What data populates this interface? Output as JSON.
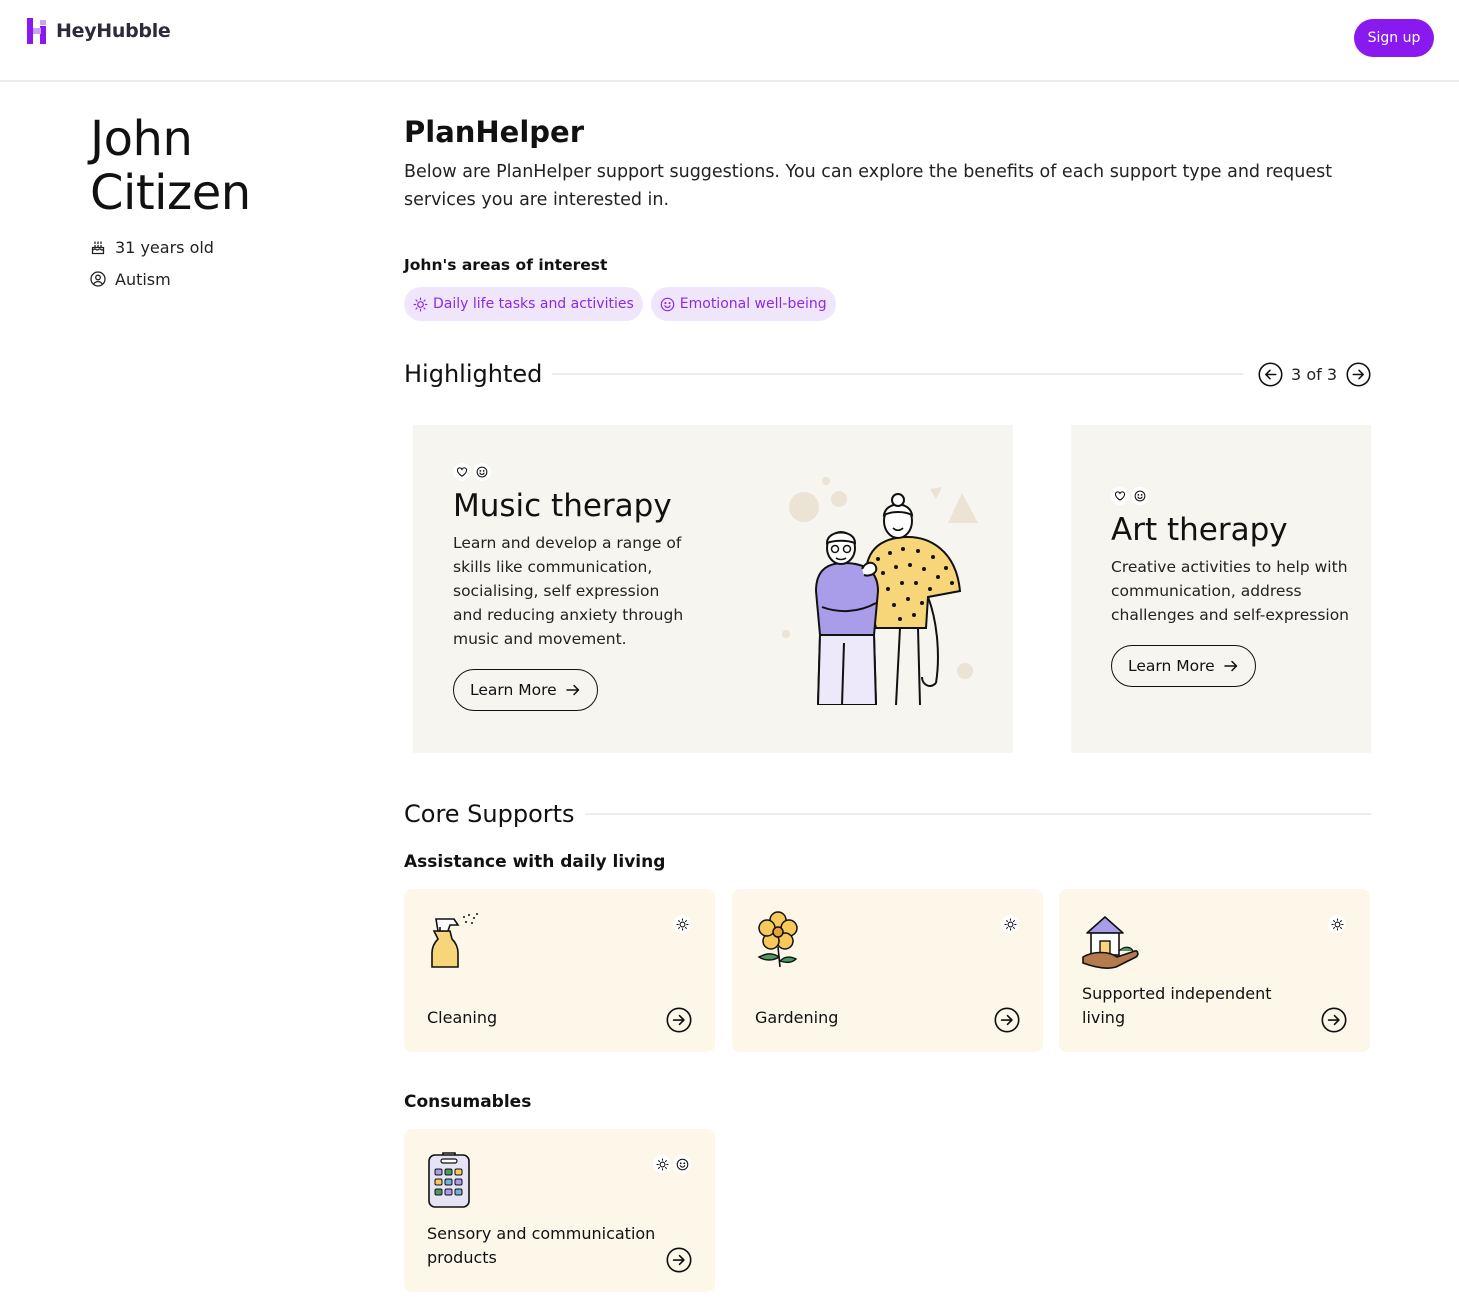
{
  "brand": {
    "name": "HeyHubble",
    "accent": "#8a19f0"
  },
  "header": {
    "signup_label": "Sign up"
  },
  "profile": {
    "first_name": "John",
    "last_name": "Citizen",
    "age": "31 years old",
    "age_icon": "cake-icon",
    "condition": "Autism",
    "condition_icon": "user-circle-icon"
  },
  "main": {
    "title": "PlanHelper",
    "intro": "Below are PlanHelper support suggestions. You can explore the benefits of each support type and request services you are interested in.",
    "interests_title": "John's areas of interest",
    "interests": [
      {
        "label": "Daily life tasks and activities",
        "icon": "sun-icon"
      },
      {
        "label": "Emotional well-being",
        "icon": "smiley-icon"
      }
    ]
  },
  "highlighted": {
    "title": "Highlighted",
    "pager": "3 of 3",
    "cards": [
      {
        "title": "Music therapy",
        "description": "Learn and develop a range of skills like communication, socialising, self expression and reducing anxiety through music and movement.",
        "button": "Learn More",
        "icons": [
          "heart-icon",
          "smiley-icon"
        ]
      },
      {
        "title": "Art therapy",
        "description": "Creative activities to help with communication, address challenges and self-expression",
        "button": "Learn More",
        "icons": [
          "heart-icon",
          "smiley-icon"
        ]
      }
    ]
  },
  "core": {
    "title": "Core Supports",
    "groups": [
      {
        "title": "Assistance with daily living",
        "items": [
          {
            "label": "Cleaning",
            "icon": "spray-bottle-icon",
            "tags": [
              "sun-icon"
            ]
          },
          {
            "label": "Gardening",
            "icon": "flower-icon",
            "tags": [
              "sun-icon"
            ]
          },
          {
            "label": "Supported independent living",
            "icon": "house-in-hand-icon",
            "tags": [
              "sun-icon"
            ]
          }
        ]
      },
      {
        "title": "Consumables",
        "items": [
          {
            "label": "Sensory and communication products",
            "icon": "communication-device-icon",
            "tags": [
              "sun-icon",
              "smiley-icon"
            ]
          }
        ]
      }
    ]
  }
}
